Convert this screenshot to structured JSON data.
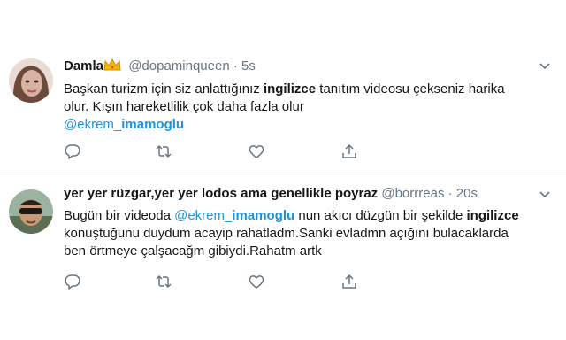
{
  "tweets": [
    {
      "name": "Damla",
      "handle": "@dopaminqueen",
      "separator": "·",
      "time": "5s",
      "lines": [
        {
          "pre": "Başkan turizm için siz anlattığınız ",
          "bold": "ingilizce",
          "post": " tanıtım videosu çekseniz harika"
        },
        {
          "text": "olur. Kışın hareketlilik çok daha fazla olur"
        },
        {
          "mention_prefix": "@ekrem_",
          "mention_bold": "imamoglu"
        }
      ]
    },
    {
      "name": "yer yer rüzgar,yer yer lodos ama genellikle poyraz",
      "handle": "@borrreas",
      "separator": "·",
      "time": "20s",
      "lines": [
        {
          "pre": "Bugün bir videoda ",
          "mention_prefix": "@ekrem_",
          "mention_bold": "imamoglu",
          "mid": " nun akıcı düzgün bir şekilde ",
          "bold": "ingilizce"
        },
        {
          "text": "konuştuğunu duydum acayip rahatladm.Sanki evladmn açığını bulacaklarda"
        },
        {
          "text": "ben örtmeye çalşacağm gibiydi.Rahatm artk"
        }
      ]
    }
  ],
  "icons": {
    "reply": "reply-icon",
    "retweet": "retweet-icon",
    "like": "like-icon",
    "share": "share-icon",
    "caret": "chevron-down-icon",
    "crown": "crown-emoji-icon"
  },
  "colors": {
    "text": "#14171a",
    "secondary": "#657786",
    "link": "#1b95e0",
    "divider": "#e6ecf0"
  }
}
